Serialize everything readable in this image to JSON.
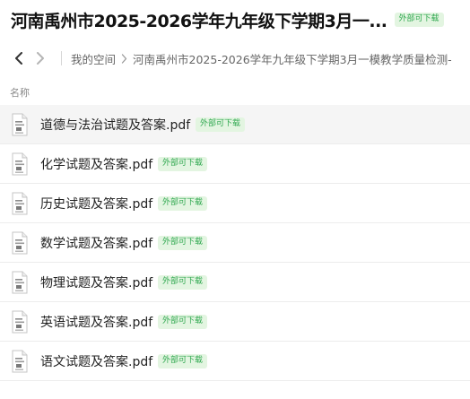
{
  "header": {
    "title": "河南禹州市2025-2026学年九年级下学期3月一...",
    "badge": "外部可下载"
  },
  "navbar": {
    "back_icon": "chevron-left-icon",
    "forward_icon": "chevron-right-icon",
    "breadcrumb": [
      "我的空间",
      "河南禹州市2025-2026学年九年级下学期3月一模教学质量检测-"
    ]
  },
  "list": {
    "column_header": "名称",
    "files": [
      {
        "name": "道德与法治试题及答案.pdf",
        "badge": "外部可下载",
        "icon": "pdf-file-icon"
      },
      {
        "name": "化学试题及答案.pdf",
        "badge": "外部可下载",
        "icon": "pdf-file-icon"
      },
      {
        "name": "历史试题及答案.pdf",
        "badge": "外部可下载",
        "icon": "pdf-file-icon"
      },
      {
        "name": "数学试题及答案.pdf",
        "badge": "外部可下载",
        "icon": "pdf-file-icon"
      },
      {
        "name": "物理试题及答案.pdf",
        "badge": "外部可下载",
        "icon": "pdf-file-icon"
      },
      {
        "name": "英语试题及答案.pdf",
        "badge": "外部可下载",
        "icon": "pdf-file-icon"
      },
      {
        "name": "语文试题及答案.pdf",
        "badge": "外部可下载",
        "icon": "pdf-file-icon"
      }
    ]
  },
  "colors": {
    "badge_bg": "#e3f5e1",
    "badge_text": "#2fa84f",
    "selected_row_bg": "#f5f5f5"
  }
}
